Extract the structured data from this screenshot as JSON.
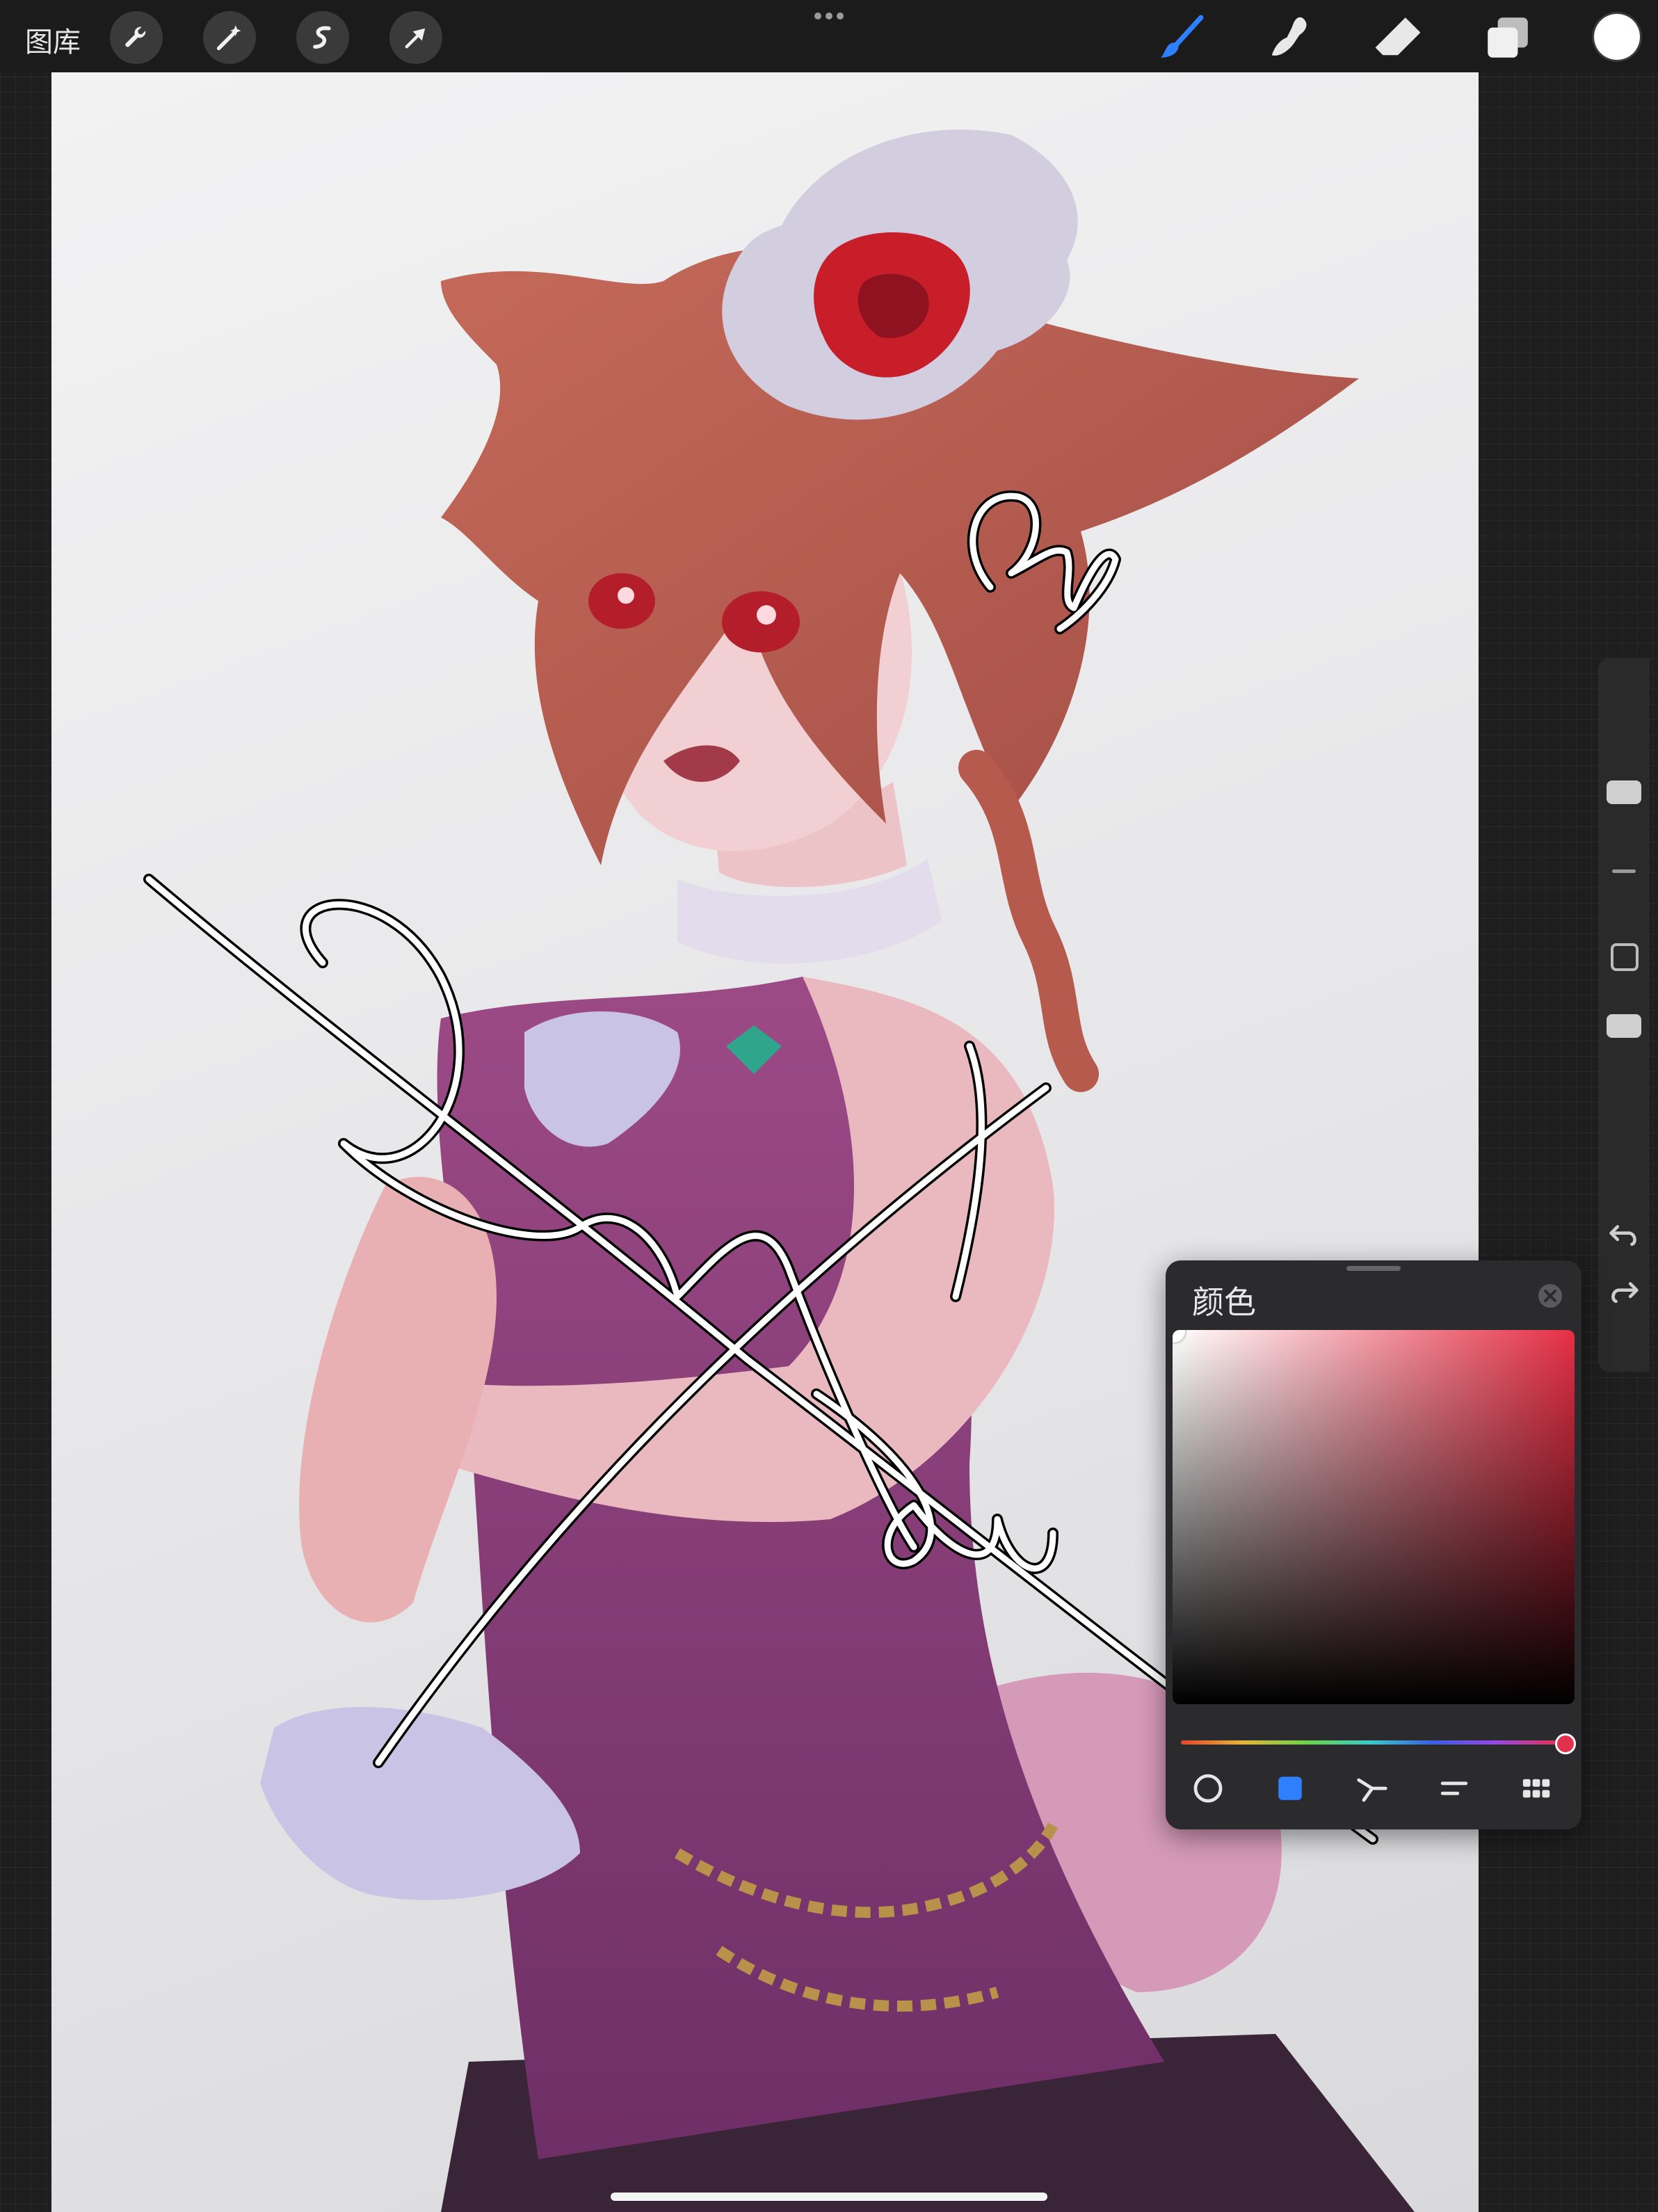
{
  "toolbar": {
    "gallery_label": "图库",
    "left_tools": [
      "wrench-icon",
      "magic-wand-icon",
      "selection-icon",
      "transform-arrow-icon"
    ],
    "right_tools": [
      "brush-icon",
      "smudge-icon",
      "eraser-icon",
      "layers-icon"
    ],
    "active_tool": "brush",
    "active_color": "#ffffff",
    "accent_color": "#2f80ff"
  },
  "sidebar": {
    "items": [
      "brush-size-slider",
      "modify-square-button",
      "opacity-slider",
      "undo-icon",
      "redo-icon"
    ]
  },
  "color_panel": {
    "title": "颜色",
    "hue_color": "#e62f45",
    "selected_color": "#ffffff",
    "modes": [
      "disc-mode-icon",
      "classic-mode-icon",
      "harmony-mode-icon",
      "value-mode-icon",
      "palettes-mode-icon"
    ],
    "active_mode": "classic"
  },
  "canvas": {
    "signature_small": "Gab",
    "signature_large": "Sam Liu"
  }
}
